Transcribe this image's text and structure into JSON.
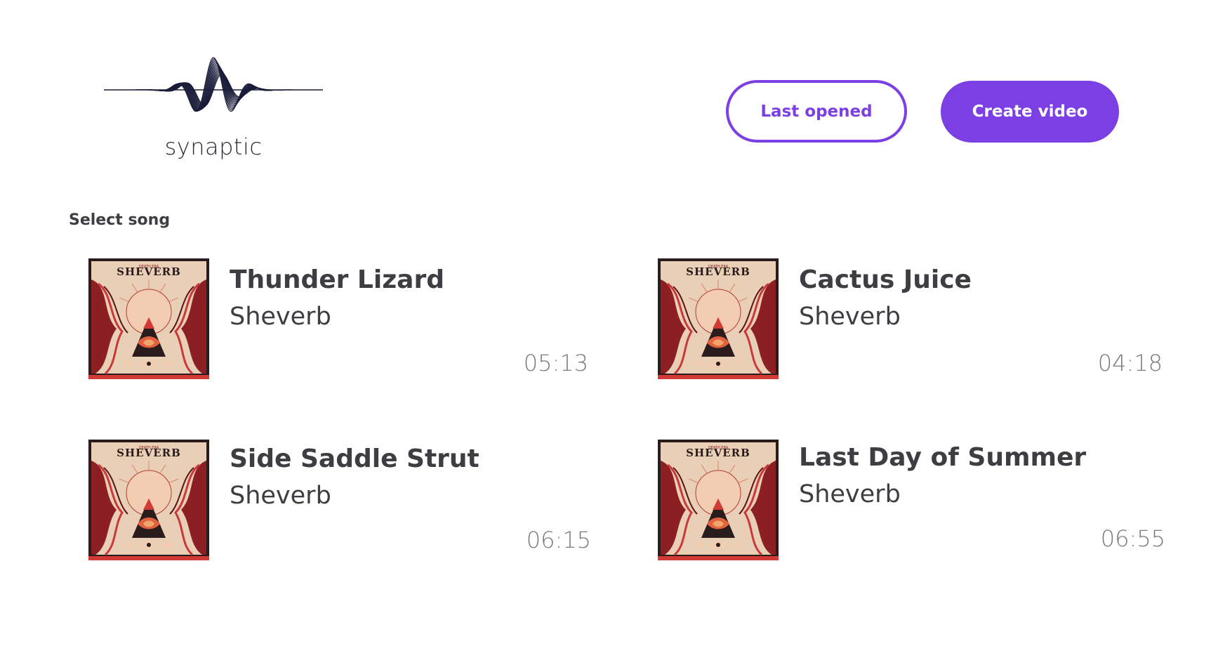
{
  "logo": {
    "text": "synaptic",
    "color": "#1a1d3a"
  },
  "header": {
    "last_opened_label": "Last opened",
    "create_video_label": "Create video",
    "accent_color": "#7b3fe4"
  },
  "main": {
    "section_label": "Select song",
    "cover_text": "SHEVERB",
    "songs": [
      {
        "title": "Thunder Lizard",
        "artist": "Sheverb",
        "duration": "05:13"
      },
      {
        "title": "Cactus Juice",
        "artist": "Sheverb",
        "duration": "04:18"
      },
      {
        "title": "Side Saddle Strut",
        "artist": "Sheverb",
        "duration": "06:15"
      },
      {
        "title": "Last Day of Summer",
        "artist": "Sheverb",
        "duration": "06:55"
      }
    ]
  }
}
